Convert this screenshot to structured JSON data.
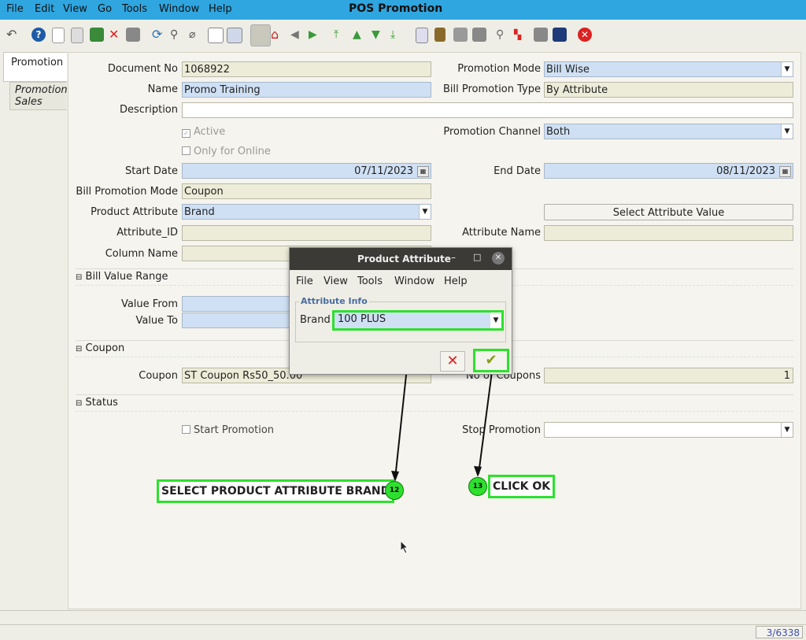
{
  "window": {
    "title": "POS Promotion",
    "menu": [
      "File",
      "Edit",
      "View",
      "Go",
      "Tools",
      "Window",
      "Help"
    ]
  },
  "tabs": {
    "promotion": "Promotion",
    "promotion_sales_1": "Promotion",
    "promotion_sales_2": "Sales"
  },
  "form": {
    "document_no_label": "Document No",
    "document_no": "1068922",
    "promotion_mode_label": "Promotion Mode",
    "promotion_mode": "Bill Wise",
    "name_label": "Name",
    "name": "Promo Training",
    "bill_promotion_type_label": "Bill Promotion Type",
    "bill_promotion_type": "By Attribute",
    "description_label": "Description",
    "description": "",
    "active_label": "Active",
    "only_online_label": "Only for Online",
    "promotion_channel_label": "Promotion Channel",
    "promotion_channel": "Both",
    "start_date_label": "Start Date",
    "start_date": "07/11/2023",
    "end_date_label": "End Date",
    "end_date": "08/11/2023",
    "bill_promotion_mode_label": "Bill Promotion Mode",
    "bill_promotion_mode": "Coupon",
    "product_attribute_label": "Product Attribute",
    "product_attribute": "Brand",
    "select_attribute_value": "Select Attribute Value",
    "attribute_id_label": "Attribute_ID",
    "attribute_name_label": "Attribute Name",
    "column_name_label": "Column Name",
    "bill_value_range": "Bill Value Range",
    "value_from_label": "Value From",
    "value_to_label": "Value To",
    "coupon_section": "Coupon",
    "coupon_label": "Coupon",
    "coupon": "ST Coupon Rs50_50.00",
    "no_of_coupons_label": "No of Coupons",
    "no_of_coupons": "1",
    "status_section": "Status",
    "start_promotion_label": "Start Promotion",
    "stop_promotion_label": "Stop Promotion"
  },
  "dialog": {
    "title": "Product Attribute",
    "menu": [
      "File",
      "View",
      "Tools",
      "Window",
      "Help"
    ],
    "group_label": "Attribute Info",
    "brand_label": "Brand",
    "brand_value": "100 PLUS"
  },
  "annotations": {
    "step12_text": "SELECT PRODUCT ATTRIBUTE BRAND",
    "step12_num": "12",
    "step13_text": "CLICK OK",
    "step13_num": "13"
  },
  "status": {
    "record_counter": "3/6338"
  },
  "colors": {
    "titlebar": "#2fa6e0",
    "highlight": "#2ee02e",
    "field_mandatory": "#cfe0f4"
  }
}
